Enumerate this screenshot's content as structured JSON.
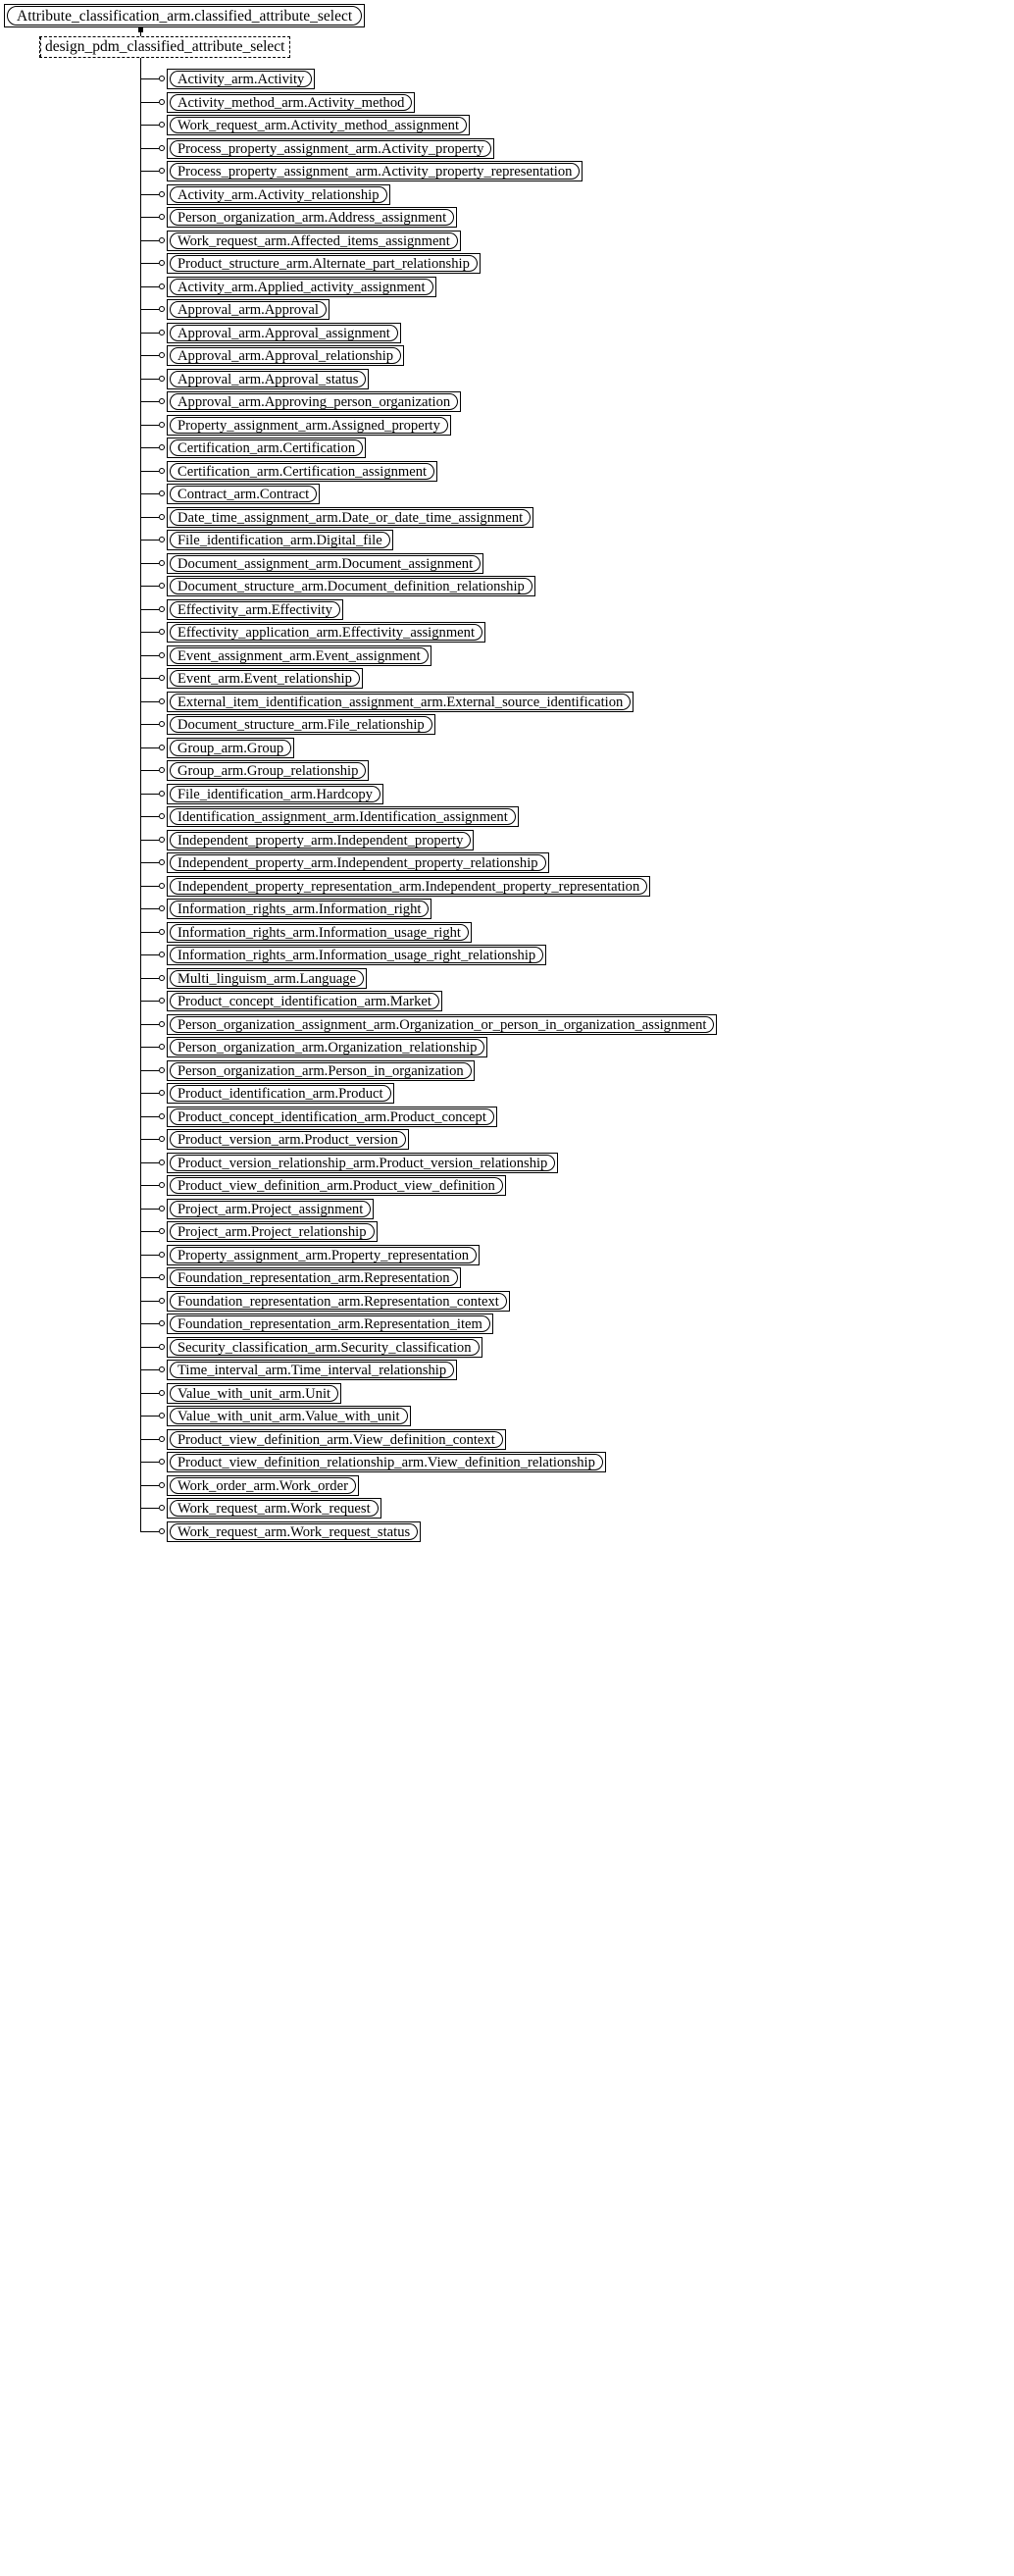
{
  "diagram": {
    "type": "express-g-entity-inheritance-tree",
    "root": {
      "label": "Attribute_classification_arm.classified_attribute_select",
      "shape": "solid-rounded-in-rect"
    },
    "select_node": {
      "label": "design_pdm_classified_attribute_select",
      "shape": "dashed-rect"
    },
    "leaves": [
      {
        "label": "Activity_arm.Activity"
      },
      {
        "label": "Activity_method_arm.Activity_method"
      },
      {
        "label": "Work_request_arm.Activity_method_assignment"
      },
      {
        "label": "Process_property_assignment_arm.Activity_property"
      },
      {
        "label": "Process_property_assignment_arm.Activity_property_representation"
      },
      {
        "label": "Activity_arm.Activity_relationship"
      },
      {
        "label": "Person_organization_arm.Address_assignment"
      },
      {
        "label": "Work_request_arm.Affected_items_assignment"
      },
      {
        "label": "Product_structure_arm.Alternate_part_relationship"
      },
      {
        "label": "Activity_arm.Applied_activity_assignment"
      },
      {
        "label": "Approval_arm.Approval"
      },
      {
        "label": "Approval_arm.Approval_assignment"
      },
      {
        "label": "Approval_arm.Approval_relationship"
      },
      {
        "label": "Approval_arm.Approval_status"
      },
      {
        "label": "Approval_arm.Approving_person_organization"
      },
      {
        "label": "Property_assignment_arm.Assigned_property"
      },
      {
        "label": "Certification_arm.Certification"
      },
      {
        "label": "Certification_arm.Certification_assignment"
      },
      {
        "label": "Contract_arm.Contract"
      },
      {
        "label": "Date_time_assignment_arm.Date_or_date_time_assignment"
      },
      {
        "label": "File_identification_arm.Digital_file"
      },
      {
        "label": "Document_assignment_arm.Document_assignment"
      },
      {
        "label": "Document_structure_arm.Document_definition_relationship"
      },
      {
        "label": "Effectivity_arm.Effectivity"
      },
      {
        "label": "Effectivity_application_arm.Effectivity_assignment"
      },
      {
        "label": "Event_assignment_arm.Event_assignment"
      },
      {
        "label": "Event_arm.Event_relationship"
      },
      {
        "label": "External_item_identification_assignment_arm.External_source_identification"
      },
      {
        "label": "Document_structure_arm.File_relationship"
      },
      {
        "label": "Group_arm.Group"
      },
      {
        "label": "Group_arm.Group_relationship"
      },
      {
        "label": "File_identification_arm.Hardcopy"
      },
      {
        "label": "Identification_assignment_arm.Identification_assignment"
      },
      {
        "label": "Independent_property_arm.Independent_property"
      },
      {
        "label": "Independent_property_arm.Independent_property_relationship"
      },
      {
        "label": "Independent_property_representation_arm.Independent_property_representation"
      },
      {
        "label": "Information_rights_arm.Information_right"
      },
      {
        "label": "Information_rights_arm.Information_usage_right"
      },
      {
        "label": "Information_rights_arm.Information_usage_right_relationship"
      },
      {
        "label": "Multi_linguism_arm.Language"
      },
      {
        "label": "Product_concept_identification_arm.Market"
      },
      {
        "label": "Person_organization_assignment_arm.Organization_or_person_in_organization_assignment"
      },
      {
        "label": "Person_organization_arm.Organization_relationship"
      },
      {
        "label": "Person_organization_arm.Person_in_organization"
      },
      {
        "label": "Product_identification_arm.Product"
      },
      {
        "label": "Product_concept_identification_arm.Product_concept"
      },
      {
        "label": "Product_version_arm.Product_version"
      },
      {
        "label": "Product_version_relationship_arm.Product_version_relationship"
      },
      {
        "label": "Product_view_definition_arm.Product_view_definition"
      },
      {
        "label": "Project_arm.Project_assignment"
      },
      {
        "label": "Project_arm.Project_relationship"
      },
      {
        "label": "Property_assignment_arm.Property_representation"
      },
      {
        "label": "Foundation_representation_arm.Representation"
      },
      {
        "label": "Foundation_representation_arm.Representation_context"
      },
      {
        "label": "Foundation_representation_arm.Representation_item"
      },
      {
        "label": "Security_classification_arm.Security_classification"
      },
      {
        "label": "Time_interval_arm.Time_interval_relationship"
      },
      {
        "label": "Value_with_unit_arm.Unit"
      },
      {
        "label": "Value_with_unit_arm.Value_with_unit"
      },
      {
        "label": "Product_view_definition_arm.View_definition_context"
      },
      {
        "label": "Product_view_definition_relationship_arm.View_definition_relationship"
      },
      {
        "label": "Work_order_arm.Work_order"
      },
      {
        "label": "Work_request_arm.Work_request"
      },
      {
        "label": "Work_request_arm.Work_request_status"
      }
    ],
    "colors": {
      "line": "#000000",
      "background": "#ffffff",
      "text": "#000000"
    }
  }
}
